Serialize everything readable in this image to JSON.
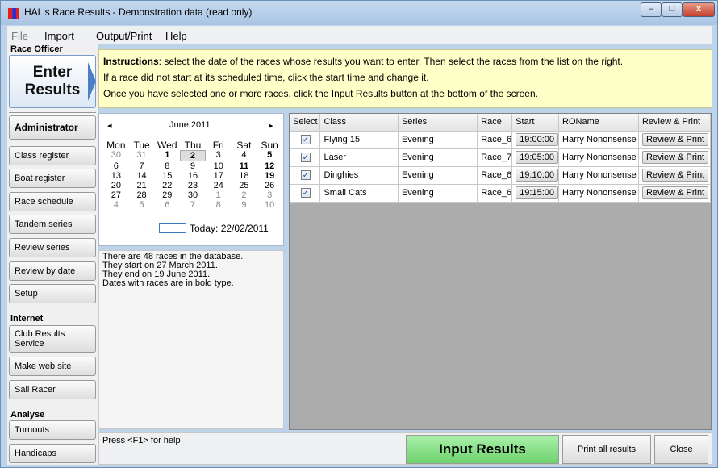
{
  "window": {
    "title": "HAL's Race Results - Demonstration data (read only)",
    "min": "–",
    "max": "□",
    "close": "x"
  },
  "menu": [
    "File",
    "Import",
    "Output/Print",
    "Help"
  ],
  "sidebar": {
    "race_officer": "Race Officer",
    "enter_line1": "Enter",
    "enter_line2": "Results",
    "administrator": "Administrator",
    "admin_items": [
      "Class register",
      "Boat register",
      "Race schedule",
      "Tandem series",
      "Review series",
      "Review by date",
      "Setup"
    ],
    "internet": "Internet",
    "internet_items": [
      "Club Results Service",
      "Make web site",
      "Sail Racer"
    ],
    "analyse": "Analyse",
    "analyse_items": [
      "Turnouts",
      "Handicaps"
    ]
  },
  "instructions": {
    "label": "Instructions",
    "line1": ": select the date of the races whose results you want to enter.  Then select the races from the list on the right.",
    "line2": "If a race did not start at its scheduled time, click the start time and change it.",
    "line3": "Once you have selected one or more races, click the Input Results button at the bottom of the screen."
  },
  "calendar": {
    "prev": "◂",
    "next": "▸",
    "month": "June 2011",
    "dows": [
      "Mon",
      "Tue",
      "Wed",
      "Thu",
      "Fri",
      "Sat",
      "Sun"
    ],
    "days": [
      [
        "30",
        "31",
        "1",
        "2",
        "3",
        "4",
        "5"
      ],
      [
        "6",
        "7",
        "8",
        "9",
        "10",
        "11",
        "12"
      ],
      [
        "13",
        "14",
        "15",
        "16",
        "17",
        "18",
        "19"
      ],
      [
        "20",
        "21",
        "22",
        "23",
        "24",
        "25",
        "26"
      ],
      [
        "27",
        "28",
        "29",
        "30",
        "1",
        "2",
        "3"
      ],
      [
        "4",
        "5",
        "6",
        "7",
        "8",
        "9",
        "10"
      ]
    ],
    "today": "Today: 22/02/2011"
  },
  "info": [
    "There are 48 races in the database.",
    "They start on 27 March 2011.",
    "They end on 19 June 2011.",
    "Dates with races are in bold type."
  ],
  "grid": {
    "headers": [
      "Select",
      "Class",
      "Series",
      "Race",
      "Start",
      "ROName",
      "Review & Print"
    ],
    "rows": [
      {
        "check": "✓",
        "class": "Flying 15",
        "series": "Evening",
        "race": "Race_6",
        "start": "19:00:00",
        "ro": "Harry Nononsense",
        "btn": "Review & Print"
      },
      {
        "check": "✓",
        "class": "Laser",
        "series": "Evening",
        "race": "Race_7",
        "start": "19:05:00",
        "ro": "Harry Nononsense",
        "btn": "Review & Print"
      },
      {
        "check": "✓",
        "class": "Dinghies",
        "series": "Evening",
        "race": "Race_6",
        "start": "19:10:00",
        "ro": "Harry Nononsense",
        "btn": "Review & Print"
      },
      {
        "check": "✓",
        "class": "Small Cats",
        "series": "Evening",
        "race": "Race_6",
        "start": "19:15:00",
        "ro": "Harry Nononsense",
        "btn": "Review & Print"
      }
    ]
  },
  "status": {
    "help": "Press <F1> for help",
    "input": "Input Results",
    "print": "Print all results",
    "close": "Close"
  },
  "colors": {
    "instructions_bg": "#ffffc8",
    "input_button": "#6fd26f",
    "title_bar": "#bcd3ea"
  }
}
